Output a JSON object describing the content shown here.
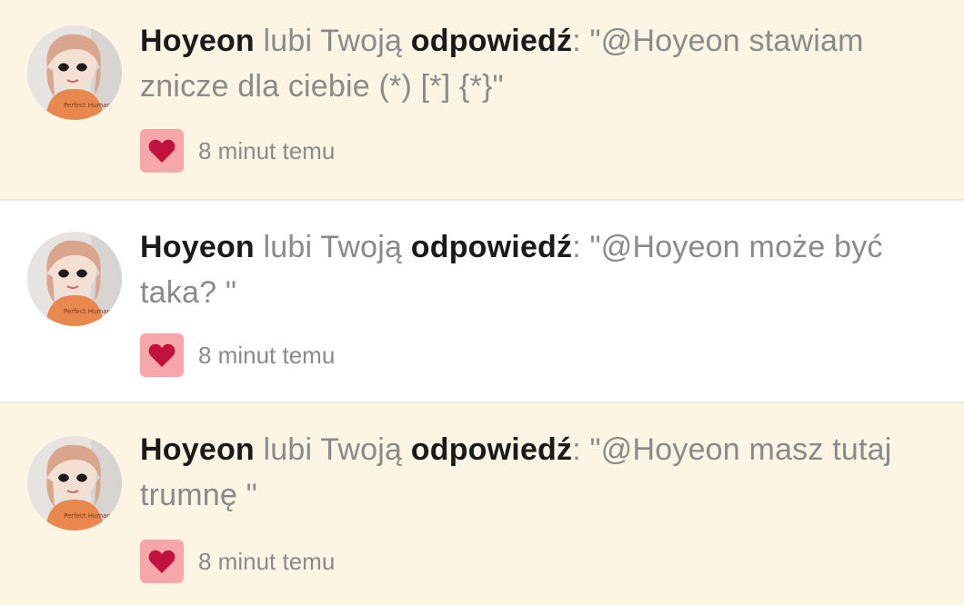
{
  "notifications": [
    {
      "user": "Hoyeon",
      "verb": "lubi Twoją",
      "object": "odpowiedź",
      "quote": "\"@Hoyeon stawiam znicze dla ciebie (*) [*] {*}\"",
      "time": "8 minut temu",
      "avatar_text": "Perfect Human",
      "read": false
    },
    {
      "user": "Hoyeon",
      "verb": "lubi Twoją",
      "object": "odpowiedź",
      "quote": "\"@Hoyeon może być taka? \"",
      "time": "8 minut temu",
      "avatar_text": "Perfect Human",
      "read": true
    },
    {
      "user": "Hoyeon",
      "verb": "lubi Twoją",
      "object": "odpowiedź",
      "quote": "\"@Hoyeon masz tutaj trumnę \"",
      "time": "8 minut temu",
      "avatar_text": "Perfect Human",
      "read": false
    }
  ],
  "colors": {
    "unread_bg": "#fdf5e4",
    "read_bg": "#ffffff",
    "heart_badge": "#f7a7a9",
    "heart": "#c0123c",
    "muted_text": "#8a8a8a",
    "strong_text": "#1a1a1a"
  },
  "icons": {
    "like_icon": "heart-icon"
  }
}
